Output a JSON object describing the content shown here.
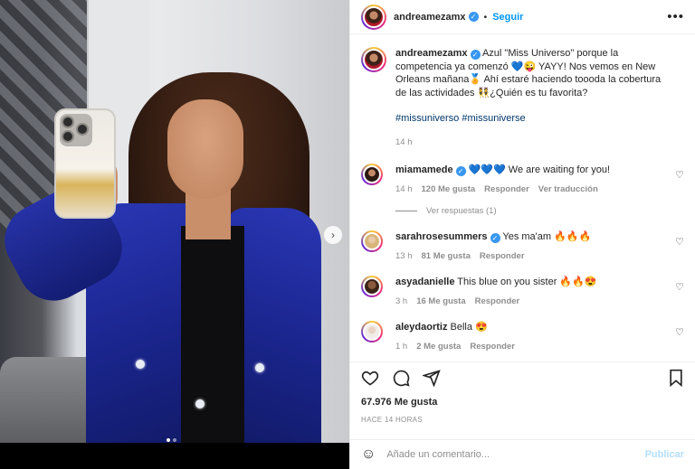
{
  "post": {
    "username": "andreamezamx",
    "follow_label": "Seguir",
    "separator": "•",
    "more_icon": "more-horizontal-icon",
    "caption_text": "Azul \"Miss Universo\" porque la competencia ya comenzó 💙😜 YAYY! Nos vemos en New Orleans mañana🏅 Ahí estaré haciendo toooda la cobertura de las actividades 👯¿Quién es tu favorita?",
    "hashtags": "#missuniverso #missuniverse",
    "caption_time": "14 h",
    "likes": "67.976 Me gusta",
    "date": "HACE 14 HORAS"
  },
  "comments": [
    {
      "username": "miamamede",
      "verified": true,
      "text": "💙💙💙 We are waiting for you!",
      "time": "14 h",
      "likes": "120 Me gusta",
      "reply": "Responder",
      "translate": "Ver traducción",
      "replies": "Ver respuestas (1)"
    },
    {
      "username": "sarahrosesummers",
      "verified": true,
      "text": "Yes ma'am 🔥🔥🔥",
      "time": "13 h",
      "likes": "81 Me gusta",
      "reply": "Responder"
    },
    {
      "username": "asyadanielle",
      "verified": false,
      "text": "This blue on you sister 🔥🔥😍",
      "time": "3 h",
      "likes": "16 Me gusta",
      "reply": "Responder"
    },
    {
      "username": "aleydaortiz",
      "verified": false,
      "text": "Bella 😍",
      "time": "1 h",
      "likes": "2 Me gusta",
      "reply": "Responder"
    }
  ],
  "composer": {
    "placeholder": "Añade un comentario...",
    "post_label": "Publicar"
  },
  "colors": {
    "accent": "#0095f6",
    "link": "#00376b",
    "muted": "#8e8e8e",
    "verified": "#3897f0"
  }
}
